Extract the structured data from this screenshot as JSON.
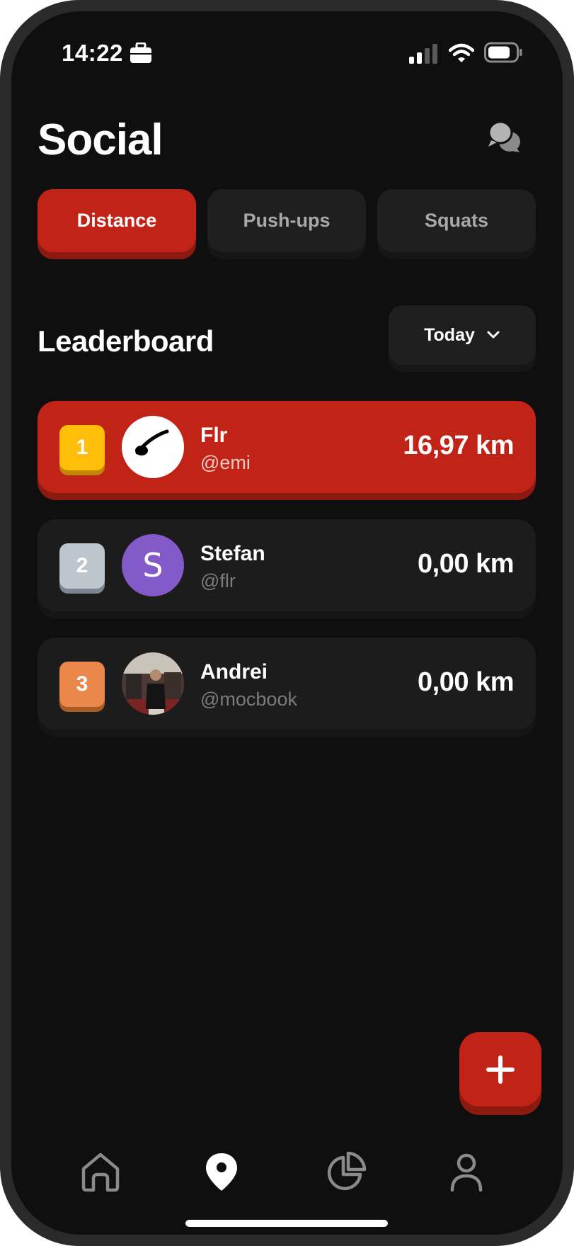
{
  "status_bar": {
    "time": "14:22"
  },
  "header": {
    "title": "Social"
  },
  "tabs": [
    {
      "label": "Distance",
      "active": true
    },
    {
      "label": "Push-ups",
      "active": false
    },
    {
      "label": "Squats",
      "active": false
    }
  ],
  "leaderboard": {
    "title": "Leaderboard",
    "period": "Today",
    "rows": [
      {
        "rank": "1",
        "name": "Flr",
        "handle": "@emi",
        "score": "16,97 km"
      },
      {
        "rank": "2",
        "name": "Stefan",
        "handle": "@flr",
        "score": "0,00 km",
        "avatar_letter": "S"
      },
      {
        "rank": "3",
        "name": "Andrei",
        "handle": "@mocbook",
        "score": "0,00 km"
      }
    ]
  },
  "colors": {
    "accent": "#c12416",
    "gold": "#ffbe0a",
    "silver": "#bdc6cc",
    "bronze": "#e9884a",
    "avatar_purple": "#8459c8"
  },
  "icons": [
    "briefcase-icon",
    "signal-icon",
    "wifi-icon",
    "battery-icon",
    "chat-bubbles-icon",
    "chevron-down-icon",
    "plus-icon",
    "home-icon",
    "map-pin-icon",
    "pie-chart-icon",
    "user-icon"
  ],
  "bottom_nav": {
    "active": "map"
  }
}
